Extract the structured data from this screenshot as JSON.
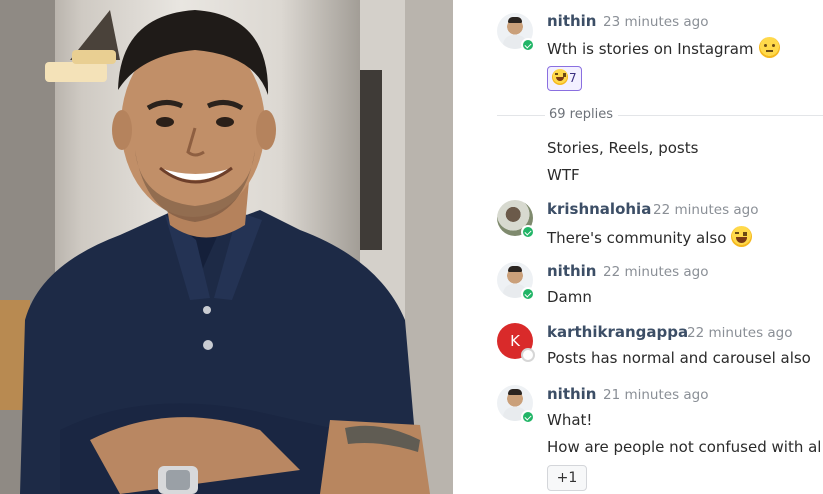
{
  "chat": {
    "messages": [
      {
        "username": "nithin",
        "time": "23 minutes ago",
        "text": "Wth is stories on Instagram",
        "emoji": "slightly-smiling-face-icon",
        "reaction": {
          "emoji": "laughing-face-icon",
          "count": "7"
        }
      }
    ],
    "replies_label": "69 replies",
    "follow_lines": [
      "Stories, Reels, posts",
      "WTF"
    ],
    "replies": [
      {
        "username": "krishnalohia",
        "time": "22 minutes ago",
        "text": "There's community also",
        "emoji": "laughing-face-icon",
        "online": true
      },
      {
        "username": "nithin",
        "time": "22 minutes ago",
        "text": "Damn",
        "online": true
      },
      {
        "username": "karthikrangappa",
        "time": "22 minutes ago",
        "text": "Posts has normal and carousel also",
        "avatar_letter": "K",
        "online": false
      },
      {
        "username": "nithin",
        "time": "21 minutes ago",
        "text": "What!",
        "text2": "How are people not confused with al",
        "online": true
      }
    ],
    "plus_reaction": "+1",
    "colors": {
      "online": "#22b567",
      "username": "#3c4e66",
      "reaction_border": "#8a6fe0",
      "avatar_k": "#d92a2a"
    }
  }
}
